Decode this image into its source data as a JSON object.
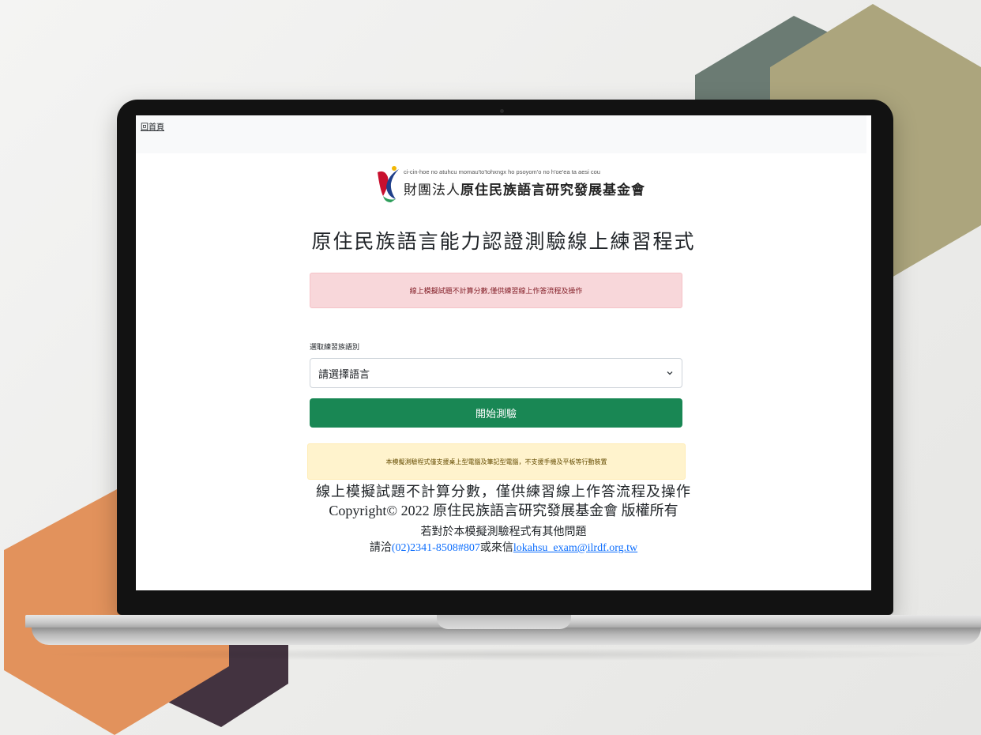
{
  "header": {
    "home_link": "回首頁"
  },
  "logo": {
    "subtitle": "ci-cin-hoe no atuhcu momau'to'tohxngx ho psoyom'o no h'oe'ea ta aesi cou",
    "prefix": "財團法人",
    "name": "原住民族語言研究發展基金會"
  },
  "main": {
    "title": "原住民族語言能力認證測驗線上練習程式",
    "notice": "線上模擬試題不計算分數,僅供練習線上作答流程及操作",
    "select_label": "選取練習族語別",
    "select_value": "請選擇語言",
    "start_button": "開始測驗",
    "device_warning": "本模擬測驗程式僅支援桌上型電腦及筆記型電腦，不支援手機及平板等行動裝置"
  },
  "footer": {
    "line1": "線上模擬試題不計算分數，僅供練習線上作答流程及操作",
    "copyright": "Copyright© 2022 原住民族語言研究發展基金會 版權所有",
    "question": "若對於本模擬測驗程式有其他問題",
    "contact_prefix": "請洽",
    "phone": "(02)2341-8508#807",
    "contact_mid": "或來信",
    "email": "lokahsu_exam@ilrdf.org.tw"
  },
  "colors": {
    "primary_button": "#198754",
    "danger_bg": "#f8d7da",
    "warning_bg": "#fff3cd",
    "hex_orange": "#e2925c",
    "hex_olive": "#aca57d",
    "hex_slate": "#6b7b73",
    "hex_plum": "#433340"
  },
  "icons": {
    "select_caret": "chevron-down-icon",
    "logo_mark": "ilrdf-logo-icon"
  }
}
